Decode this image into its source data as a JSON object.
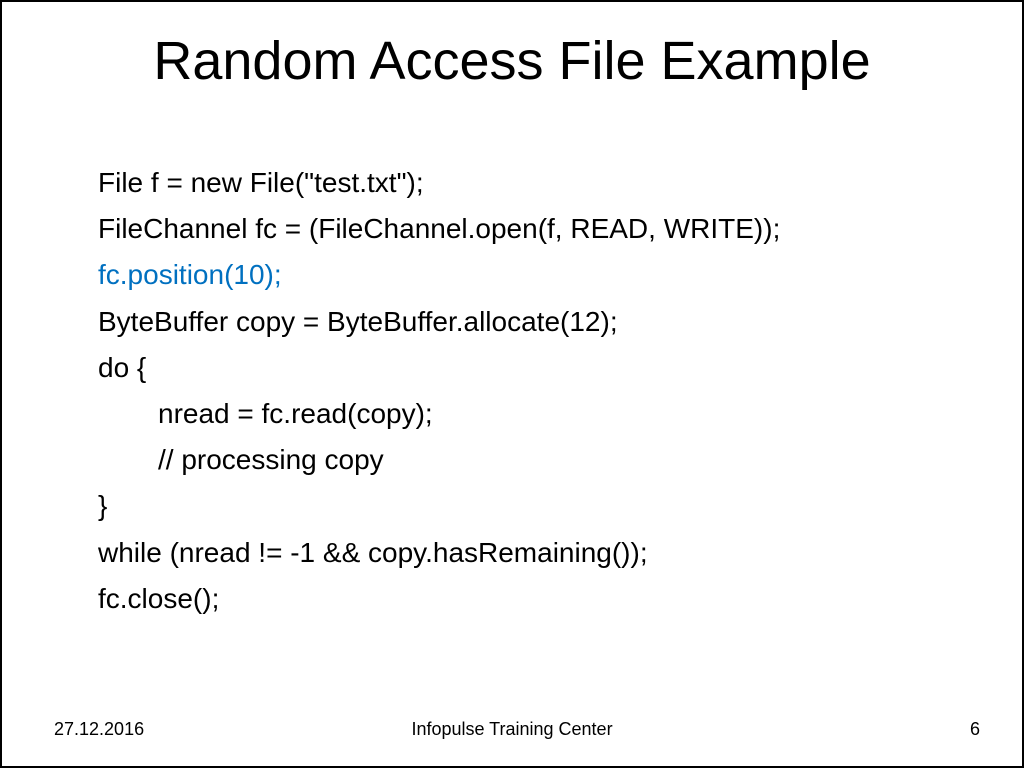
{
  "slide": {
    "title": "Random Access File Example",
    "code": {
      "line1": "File f = new File(\"test.txt\");",
      "line2": "FileChannel fc = (FileChannel.open(f, READ, WRITE));",
      "line3": "fc.position(10);",
      "line4": "ByteBuffer copy = ByteBuffer.allocate(12);",
      "line5": "do {",
      "line6": "nread = fc.read(copy);",
      "line7": "// processing copy",
      "line8": "}",
      "line9": "while (nread != -1 && copy.hasRemaining());",
      "line10": "fc.close();"
    },
    "footer": {
      "date": "27.12.2016",
      "center": "Infopulse Training Center",
      "page": "6"
    }
  }
}
